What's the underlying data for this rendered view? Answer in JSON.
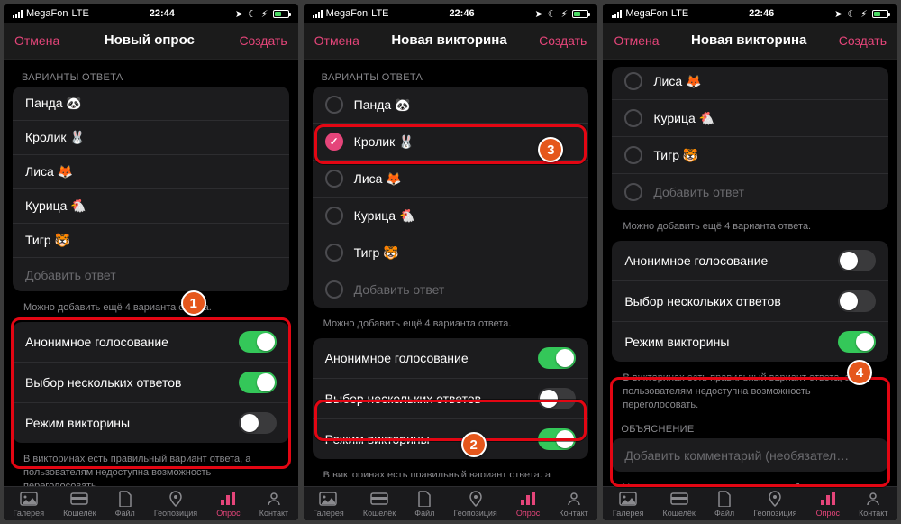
{
  "status": {
    "carrier": "MegaFon",
    "net": "LTE",
    "t1": "22:44",
    "t2": "22:46",
    "t3": "22:46"
  },
  "nav": {
    "cancel": "Отмена",
    "title_poll": "Новый опрос",
    "title_quiz": "Новая викторина",
    "create": "Создать"
  },
  "sections": {
    "answers": "ВАРИАНТЫ ОТВЕТА",
    "explain": "ОБЪЯСНЕНИЕ"
  },
  "answers": {
    "a0": "Панда 🐼",
    "a1": "Кролик 🐰",
    "a2": "Лиса 🦊",
    "a3": "Курица 🐔",
    "a4": "Тигр 🐯",
    "add": "Добавить ответ"
  },
  "notes": {
    "more4": "Можно добавить ещё 4 варианта ответа.",
    "quiz_info": "В викторинах есть правильный вариант ответа, а пользователям недоступна возможность переголосовать.",
    "explain_info": "Участники увидят этот текст, если выберут неправильный ответ (полезно для образовательных тестов)."
  },
  "settings": {
    "anon": "Анонимное голосование",
    "multi": "Выбор нескольких ответов",
    "quiz": "Режим викторины"
  },
  "explain": {
    "placeholder": "Добавить комментарий (необязател…"
  },
  "tabs": {
    "gallery": "Галерея",
    "wallet": "Кошелёк",
    "file": "Файл",
    "geo": "Геопозиция",
    "poll": "Опрос",
    "contact": "Контакт"
  }
}
